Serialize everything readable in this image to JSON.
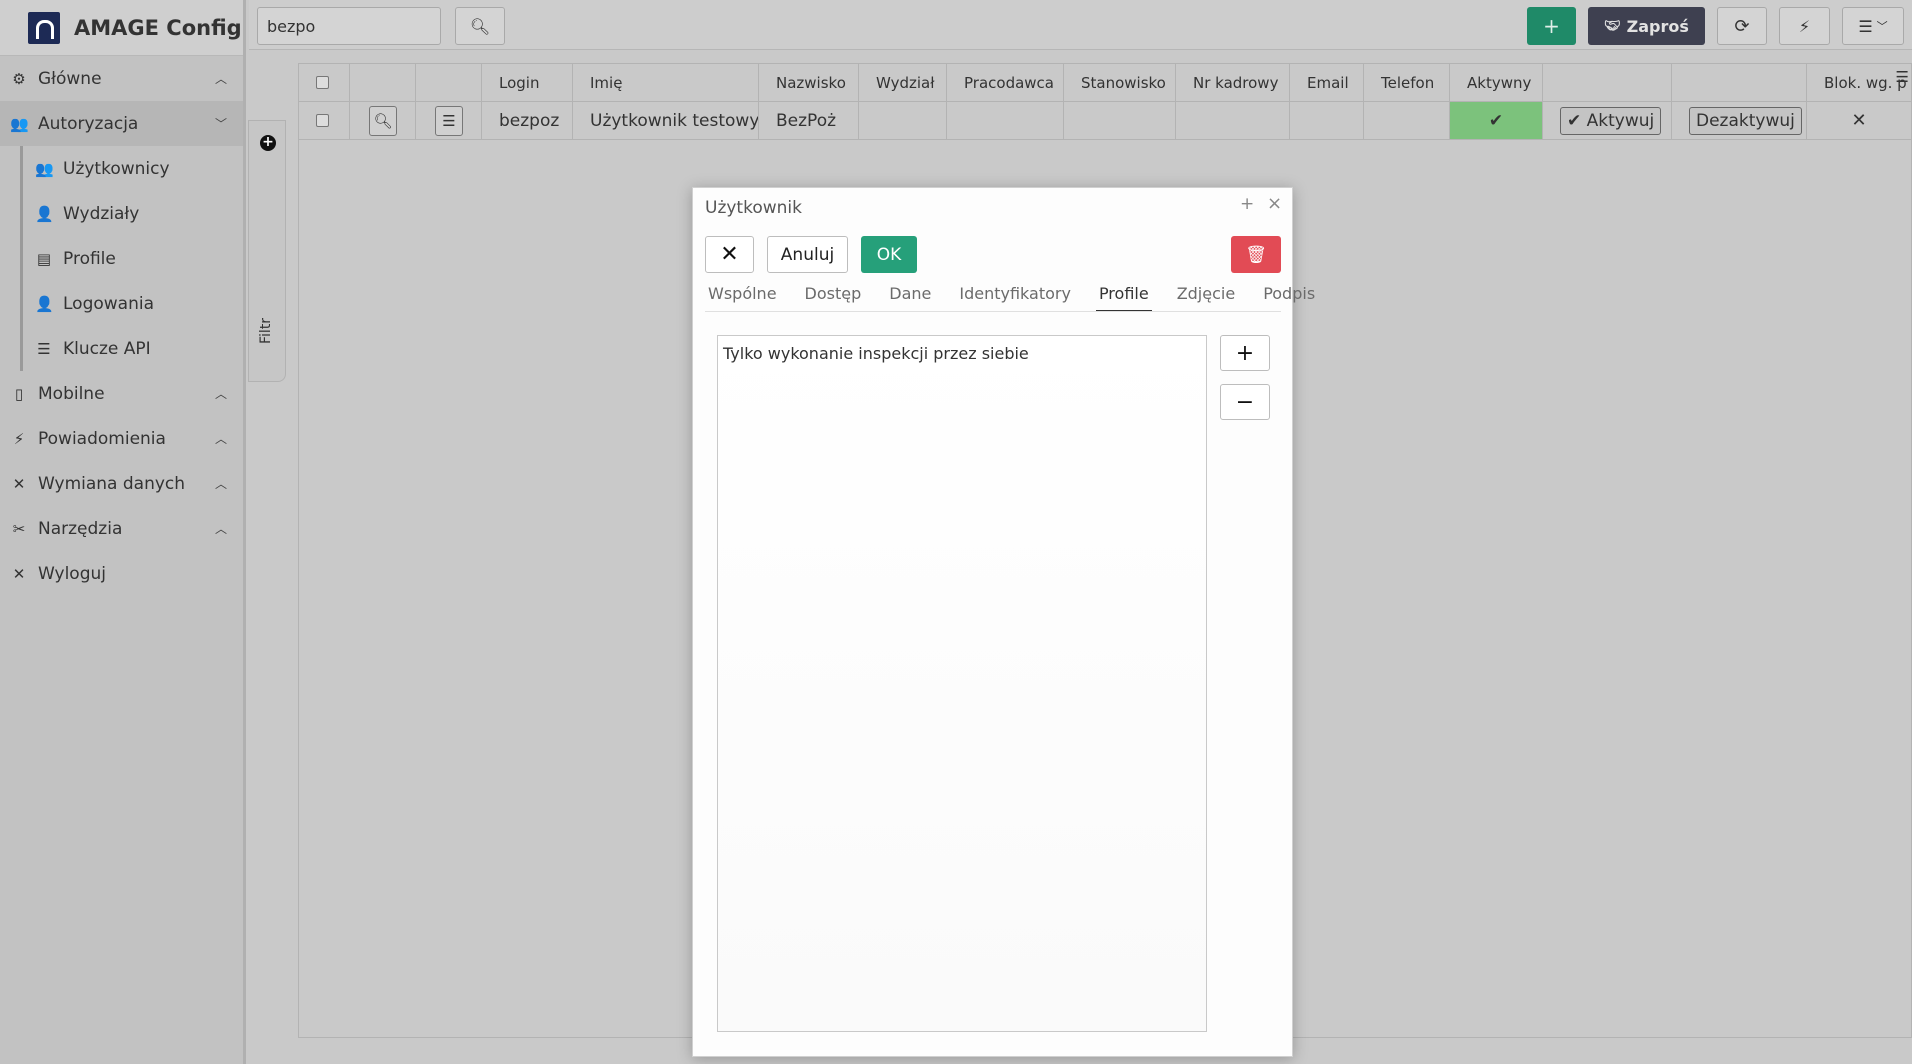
{
  "app": {
    "title": "AMAGE Config"
  },
  "sidebar": {
    "items": [
      {
        "label": "Główne",
        "icon": "gear-icon",
        "state": "collapsed"
      },
      {
        "label": "Autoryzacja",
        "icon": "users-icon",
        "state": "expanded"
      },
      {
        "label": "Mobilne",
        "icon": "mobile-icon",
        "state": "collapsed"
      },
      {
        "label": "Powiadomienia",
        "icon": "bolt-icon",
        "state": "collapsed"
      },
      {
        "label": "Wymiana danych",
        "icon": "cross-icon",
        "state": "collapsed"
      },
      {
        "label": "Narzędzia",
        "icon": "tools-icon",
        "state": "collapsed"
      },
      {
        "label": "Wyloguj",
        "icon": "cross-icon"
      }
    ],
    "subitems": [
      {
        "label": "Użytkownicy",
        "icon": "users-icon"
      },
      {
        "label": "Wydziały",
        "icon": "user-icon"
      },
      {
        "label": "Profile",
        "icon": "id-card-icon"
      },
      {
        "label": "Logowania",
        "icon": "user-icon"
      },
      {
        "label": "Klucze API",
        "icon": "list-icon"
      }
    ]
  },
  "filter": {
    "label": "Filtr"
  },
  "toolbar": {
    "search_value": "bezpo",
    "add_label": "+",
    "invite_label": "Zaproś",
    "accent_green": "#1f8a68",
    "invite_bg": "#3e4050"
  },
  "grid": {
    "headers": [
      "Login",
      "Imię",
      "Nazwisko",
      "Wydział",
      "Pracodawca",
      "Stanowisko",
      "Nr kadrowy",
      "Email",
      "Telefon",
      "Aktywny",
      "",
      "",
      "Blok. wg. p"
    ],
    "rows": [
      {
        "login": "bezpoz",
        "imie": "Użytkownik testowy",
        "nazwisko": "BezPoż",
        "wydzial": "",
        "pracodawca": "",
        "stanowisko": "",
        "nr_kadrowy": "",
        "email": "",
        "telefon": "",
        "aktywny": "✔",
        "aktywuj_label": "Aktywuj",
        "dezaktywuj_label": "Dezaktywuj",
        "blok": "✕"
      }
    ]
  },
  "dialog": {
    "title": "Użytkownik",
    "cancel_label": "Anuluj",
    "ok_label": "OK",
    "tabs": [
      "Wspólne",
      "Dostęp",
      "Dane",
      "Identyfikatory",
      "Profile",
      "Zdjęcie",
      "Podpis"
    ],
    "active_tab": "Profile",
    "profiles": [
      "Tylko wykonanie inspekcji przez siebie"
    ],
    "add_label": "+",
    "remove_label": "−",
    "ok_color": "#26a07a",
    "delete_color": "#e24b55"
  }
}
